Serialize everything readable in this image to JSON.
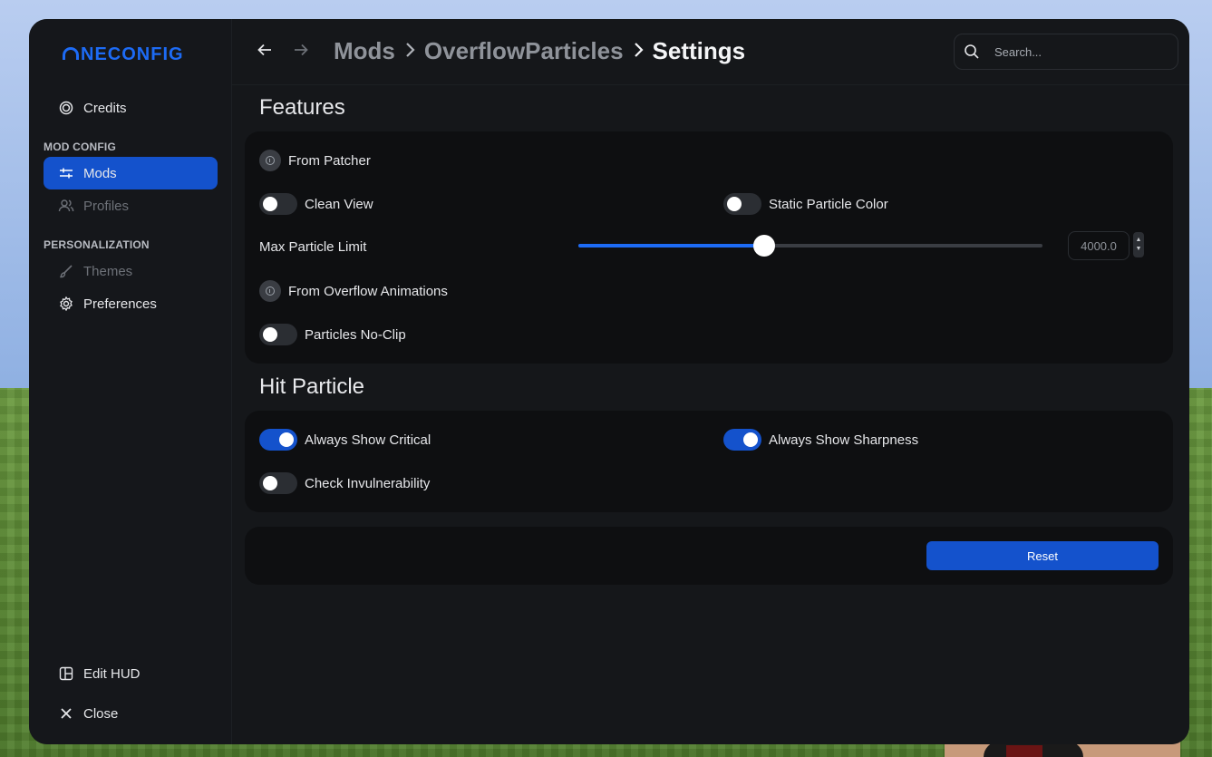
{
  "sidebar": {
    "logo": "NECONFIG",
    "credits": "Credits",
    "mod_config_heading": "MOD CONFIG",
    "mods": "Mods",
    "profiles": "Profiles",
    "personalization_heading": "PERSONALIZATION",
    "themes": "Themes",
    "preferences": "Preferences",
    "edit_hud": "Edit HUD",
    "close": "Close"
  },
  "header": {
    "back_icon": "arrow-left-icon",
    "forward_icon": "arrow-right-icon",
    "breadcrumb": [
      "Mods",
      "OverflowParticles",
      "Settings"
    ],
    "search_placeholder": "Search..."
  },
  "features": {
    "title": "Features",
    "from_patcher": "From Patcher",
    "clean_view": {
      "label": "Clean View",
      "on": false
    },
    "static_particle_color": {
      "label": "Static Particle Color",
      "on": false
    },
    "max_particle_limit": {
      "label": "Max Particle Limit",
      "value": "4000.0",
      "fraction": 0.4
    },
    "from_overflow_animations": "From Overflow Animations",
    "particles_no_clip": {
      "label": "Particles No-Clip",
      "on": false
    }
  },
  "hit_particle": {
    "title": "Hit Particle",
    "always_show_critical": {
      "label": "Always Show Critical",
      "on": true
    },
    "always_show_sharpness": {
      "label": "Always Show Sharpness",
      "on": true
    },
    "check_invulnerability": {
      "label": "Check Invulnerability",
      "on": false
    }
  },
  "footer": {
    "reset": "Reset"
  },
  "colors": {
    "accent": "#1452cc",
    "slider": "#1d6bf5",
    "panel": "#0e0f11",
    "background": "#15171a"
  }
}
